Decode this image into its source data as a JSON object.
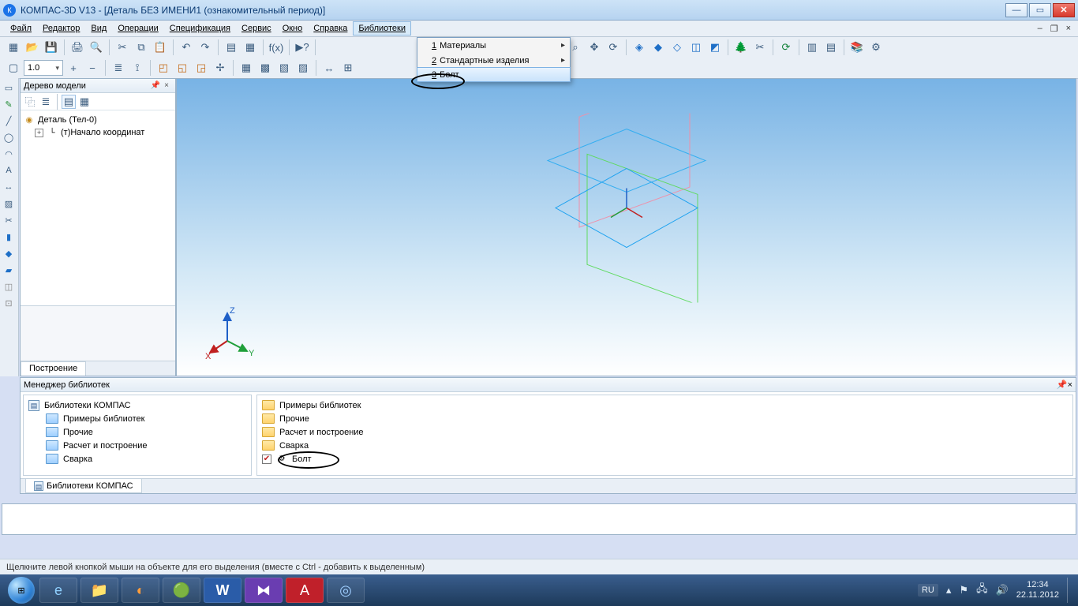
{
  "titlebar": {
    "text": "КОМПАС-3D V13 - [Деталь БЕЗ ИМЕНИ1 (ознакомительный период)]"
  },
  "menu": {
    "items": [
      {
        "label": "Файл",
        "u": 0
      },
      {
        "label": "Редактор",
        "u": 0
      },
      {
        "label": "Вид",
        "u": 0
      },
      {
        "label": "Операции",
        "u": 0
      },
      {
        "label": "Спецификация",
        "u": 0
      },
      {
        "label": "Сервис",
        "u": 0
      },
      {
        "label": "Окно",
        "u": 0
      },
      {
        "label": "Справка",
        "u": 0
      },
      {
        "label": "Библиотеки",
        "u": 0,
        "active": true
      }
    ],
    "dropdown": [
      {
        "num": "1",
        "label": "Материалы",
        "sub": true
      },
      {
        "num": "2",
        "label": "Стандартные изделия",
        "sub": true
      },
      {
        "num": "3",
        "label": "Болт",
        "sub": false,
        "hover": true
      }
    ]
  },
  "toolbar": {
    "row2_scale": "1.0"
  },
  "tree_panel": {
    "title": "Дерево модели",
    "root": "Деталь (Тел-0)",
    "child": "(т)Начало координат",
    "tab": "Построение"
  },
  "libmgr": {
    "title": "Менеджер библиотек",
    "left_root": "Библиотеки КОМПАС",
    "left_items": [
      "Примеры библиотек",
      "Прочие",
      "Расчет и построение",
      "Сварка"
    ],
    "right_items": [
      "Примеры библиотек",
      "Прочие",
      "Расчет и построение",
      "Сварка"
    ],
    "right_exec": "Болт",
    "tab": "Библиотеки КОМПАС"
  },
  "status": {
    "text": "Щелкните левой кнопкой мыши на объекте для его выделения (вместе с Ctrl - добавить к выделенным)"
  },
  "tray": {
    "lang": "RU",
    "time": "12:34",
    "date": "22.11.2012"
  },
  "axis": {
    "x": "X",
    "y": "Y",
    "z": "Z"
  }
}
